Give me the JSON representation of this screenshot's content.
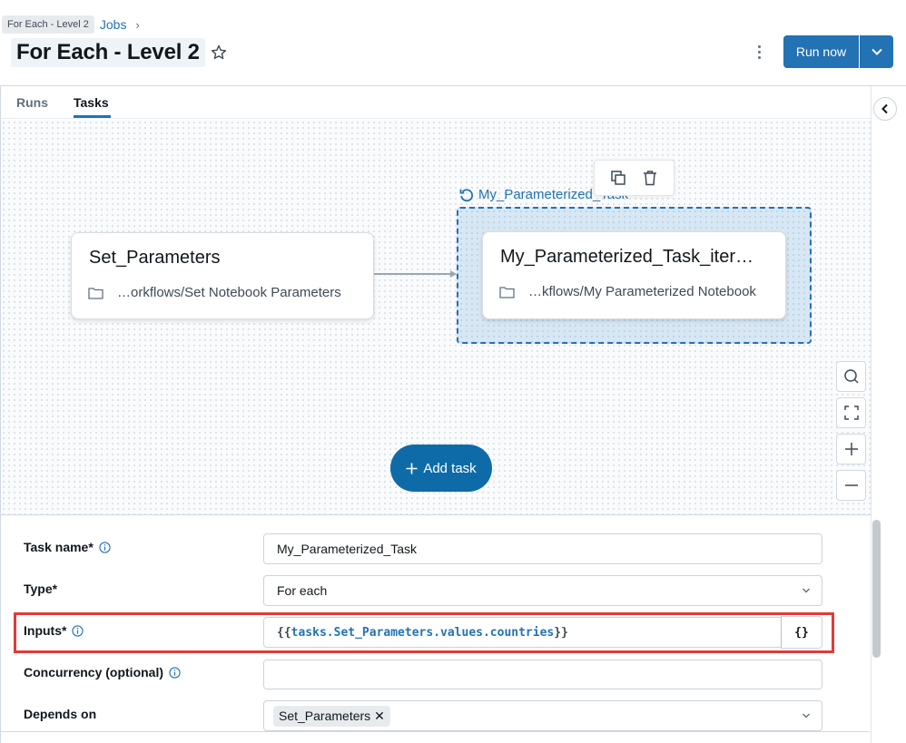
{
  "header": {
    "tooltip": "For Each - Level 2",
    "breadcrumb_link": "Jobs",
    "breadcrumb_separator": "›",
    "title": "For Each - Level 2",
    "run_now_label": "Run now"
  },
  "tabs": [
    {
      "label": "Runs",
      "active": false
    },
    {
      "label": "Tasks",
      "active": true
    }
  ],
  "canvas": {
    "nodes": [
      {
        "title": "Set_Parameters",
        "path": "…orkflows/Set Notebook Parameters"
      },
      {
        "title": "My_Parameterized_Task_iter…",
        "path": "…kflows/My Parameterized Notebook"
      }
    ],
    "foreach_label": "My_Parameterized_Task",
    "add_task_label": "Add task"
  },
  "form": {
    "task_name": {
      "label": "Task name*",
      "value": "My_Parameterized_Task"
    },
    "type": {
      "label": "Type*",
      "value": "For each"
    },
    "inputs": {
      "label": "Inputs*",
      "open": "{{",
      "value": "tasks.Set_Parameters.values.countries",
      "close": "}}",
      "json_button": "{}"
    },
    "concurrency": {
      "label": "Concurrency (optional)",
      "value": ""
    },
    "depends_on": {
      "label": "Depends on",
      "chips": [
        "Set_Parameters"
      ]
    }
  },
  "colors": {
    "accent": "#2272b4",
    "highlight": "#e03a3a",
    "add_task": "#0e6ba8"
  }
}
